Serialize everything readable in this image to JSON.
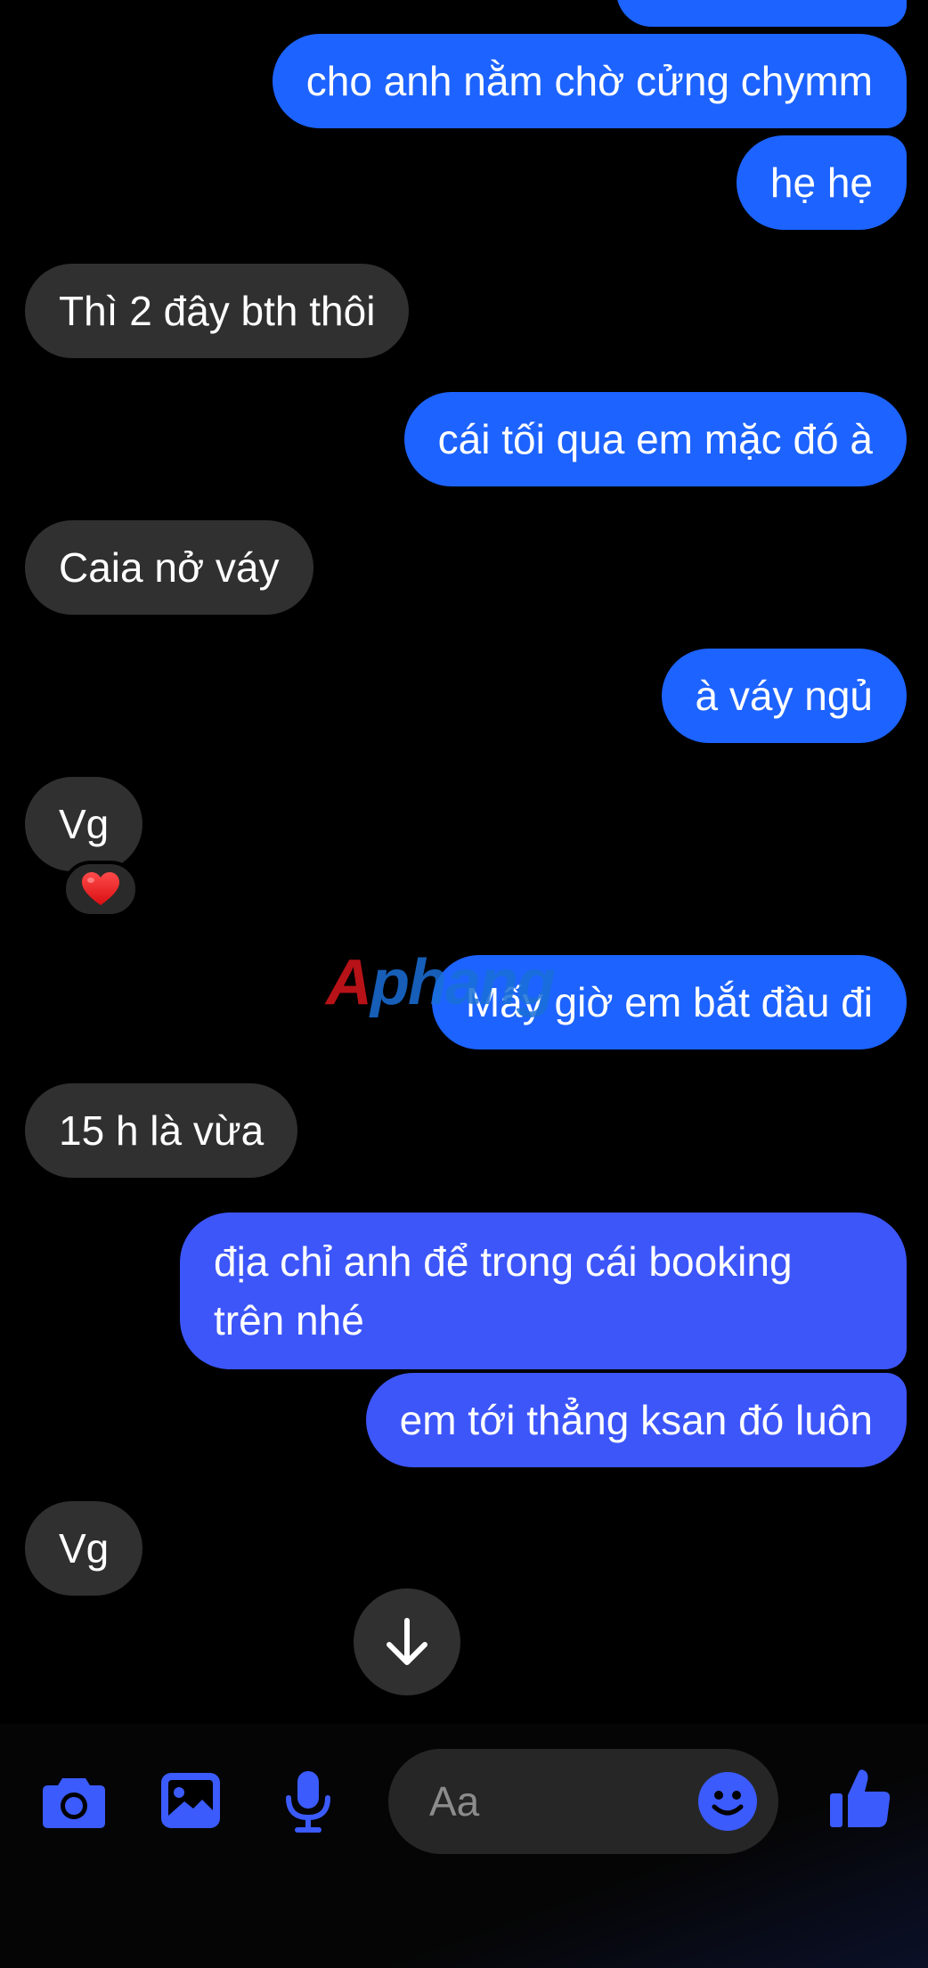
{
  "messages": [
    {
      "text": "cho anh nằm chờ cửng chymm"
    },
    {
      "text": "hẹ hẹ"
    },
    {
      "text": "Thì 2 đây bth thôi"
    },
    {
      "text": "cái tối qua em mặc đó à"
    },
    {
      "text": "Caia nở váy"
    },
    {
      "text": "à váy ngủ"
    },
    {
      "text": "Vg",
      "reaction": "❤️"
    },
    {
      "text": "Mấy giờ em bắt đầu đi"
    },
    {
      "text": "15 h là vừa"
    },
    {
      "text": "địa chỉ anh để trong cái booking trên nhé"
    },
    {
      "text": "em tới thẳng ksan đó luôn"
    },
    {
      "text": "Vg"
    }
  ],
  "watermark": {
    "part1": "A",
    "part2": "phang"
  },
  "composer": {
    "placeholder": "Aa",
    "icons": [
      "camera-icon",
      "gallery-icon",
      "microphone-icon",
      "emoji-icon",
      "thumbs-up-icon"
    ]
  },
  "colors": {
    "outgoing": "#1d63ff",
    "outgoing_lower": "#3d56fa",
    "incoming": "#303030",
    "accent_icon": "#3b5bfd"
  }
}
